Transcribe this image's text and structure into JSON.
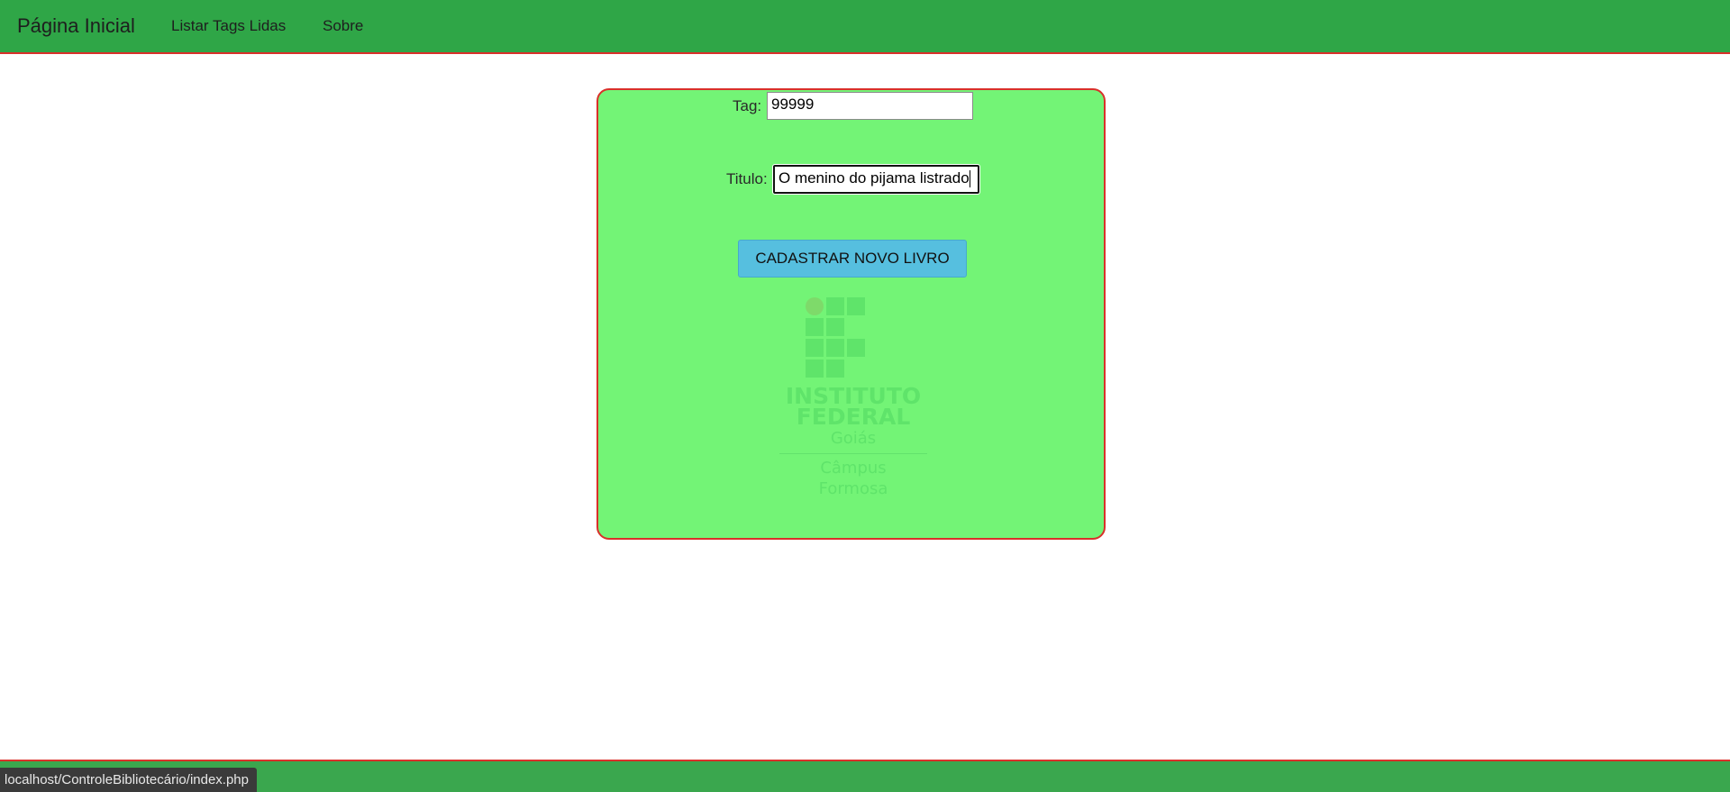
{
  "navbar": {
    "brand": "Página Inicial",
    "links": [
      {
        "label": "Listar Tags Lidas"
      },
      {
        "label": "Sobre"
      }
    ],
    "background": "#2fa647",
    "border_color": "#d9302a"
  },
  "form": {
    "tag_label": "Tag:",
    "tag_value": "99999",
    "titulo_label": "Titulo:",
    "titulo_value": "O menino do pijama listrado",
    "submit_label": "CADASTRAR NOVO LIVRO",
    "background": "#73f476",
    "button_color": "#56bfdf"
  },
  "logo": {
    "line1": "INSTITUTO",
    "line2": "FEDERAL",
    "line3": "Goiás",
    "line4": "Câmpus",
    "line5": "Formosa",
    "icon": "instituto-federal-logo"
  },
  "status_bar": {
    "url": "localhost/ControleBibliotecário/index.php"
  }
}
